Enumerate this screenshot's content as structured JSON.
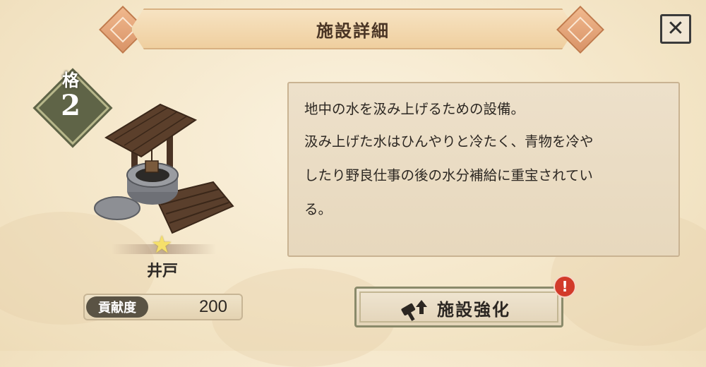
{
  "header": {
    "title": "施設詳細",
    "close_label": "✕"
  },
  "facility": {
    "grade_label": "格",
    "grade_value": "2",
    "name": "井戸",
    "contribution_label": "貢献度",
    "contribution_value": "200"
  },
  "description": {
    "lines": [
      "地中の水を汲み上げるための設備。",
      "汲み上げた水はひんやりと冷たく、青物を冷や",
      "したり野良仕事の後の水分補給に重宝されてい",
      "る。"
    ]
  },
  "upgrade": {
    "label": "施設強化",
    "alert": "!"
  },
  "icons": {
    "close": "close-icon",
    "star": "star-icon",
    "hammer": "hammer-upgrade-icon",
    "alert": "alert-icon"
  },
  "colors": {
    "accent": "#d99468",
    "alert": "#d23a2a",
    "badge": "#5f6447"
  }
}
